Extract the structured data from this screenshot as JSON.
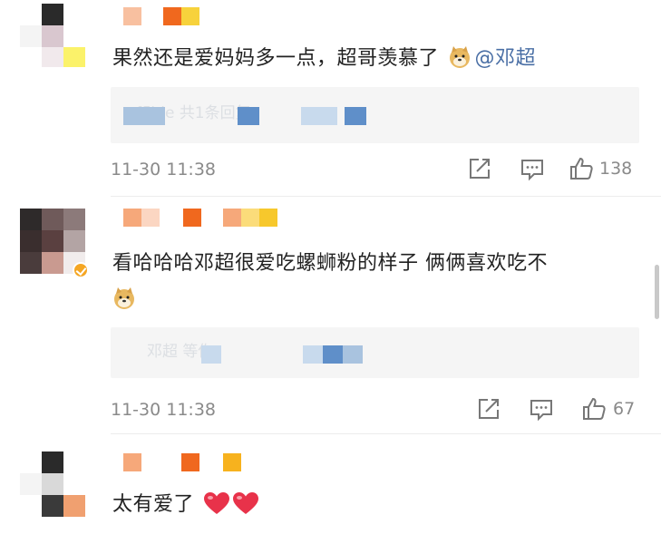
{
  "comments": [
    {
      "text": "果然还是爱妈妈多一点，超哥羡慕了",
      "emoji": "doge-emoji",
      "mention": "@邓超",
      "reply_preview": "fflble 共1条回复",
      "timestamp": "11-30 11:38",
      "likes": "138",
      "verified": false
    },
    {
      "text_line1": "看哈哈哈邓超很爱吃螺蛳粉的样子 俩俩喜欢吃不",
      "emoji": "doge-emoji",
      "reply_preview": "邓超 等你",
      "timestamp": "11-30 11:38",
      "likes": "67",
      "verified": true
    },
    {
      "text": "太有爱了",
      "emoji": "heart-emoji"
    }
  ],
  "icons": {
    "share": "share-icon",
    "comment": "comment-icon",
    "like": "thumbs-up-icon"
  },
  "colors": {
    "mention": "#4a6fa5",
    "meta": "#8a8a8a",
    "verified_badge": "#f5a623",
    "reply_bg": "#f5f5f5",
    "heart": "#e8324a"
  }
}
